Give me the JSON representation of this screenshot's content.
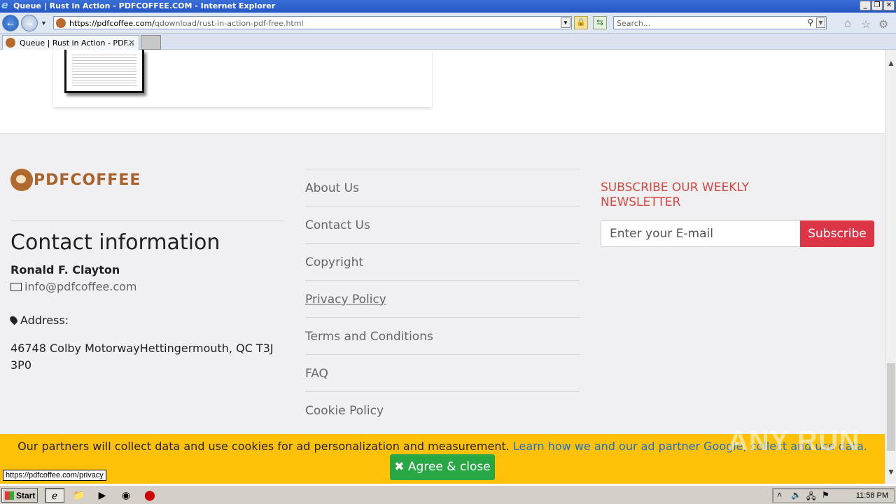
{
  "window": {
    "title": "Queue | Rust in Action - PDFCOFFEE.COM - Internet Explorer",
    "controls": [
      "_",
      "❐",
      "✕"
    ]
  },
  "address_bar": {
    "url_host": "https://pdfcoffee.com/",
    "url_path": "qdownload/rust-in-action-pdf-free.html",
    "search_placeholder": "Search..."
  },
  "tab": {
    "label": "Queue | Rust in Action - PDF...",
    "close": "✕"
  },
  "footer": {
    "logo_text": "PDFCOFFEE",
    "contact_title": "Contact information",
    "person": "Ronald F. Clayton",
    "email": "info@pdfcoffee.com",
    "address_label": "Address:",
    "address": "46748 Colby MotorwayHettingermouth, QC T3J 3P0",
    "links": [
      "About Us",
      "Contact Us",
      "Copyright",
      "Privacy Policy",
      "Terms and Conditions",
      "FAQ",
      "Cookie Policy"
    ],
    "newsletter_title": "SUBSCRIBE OUR WEEKLY NEWSLETTER",
    "email_placeholder": "Enter your E-mail",
    "subscribe_label": "Subscribe"
  },
  "cookie": {
    "message": "Our partners will collect data and use cookies for ad personalization and measurement.",
    "link_text": "Learn how we and our ad partner Google, collect and use data.",
    "agree_label": "Agree & close"
  },
  "watermark": "ANY RUN",
  "status_url": "https://pdfcoffee.com/privacy",
  "taskbar": {
    "start_label": "Start",
    "clock": "11:58 PM"
  },
  "colors": {
    "accent_red": "#dc3545",
    "cookie_bg": "#ffc107",
    "agree_green": "#28a745",
    "logo_brown": "#a8642c"
  }
}
